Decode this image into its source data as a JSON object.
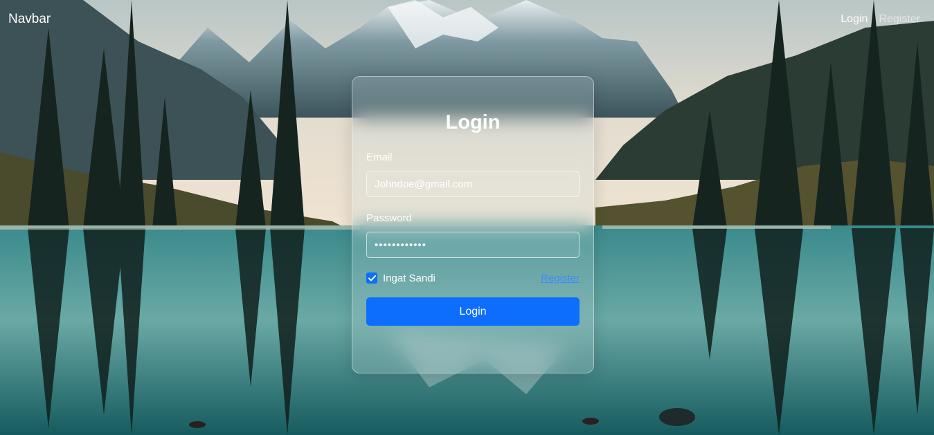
{
  "navbar": {
    "brand": "Navbar",
    "links": [
      {
        "label": "Login",
        "active": true
      },
      {
        "label": "Register",
        "active": false
      }
    ]
  },
  "background": {
    "image": "mountain-lake-forest-landscape",
    "colors": {
      "sky": "#dcd4c8",
      "mountains": "#4d6a72",
      "forest": "#1e2e22",
      "water": "#2f7e82"
    }
  },
  "login_card": {
    "title": "Login",
    "email": {
      "label": "Email",
      "value": "Johndoe@gmail.com"
    },
    "password": {
      "label": "Password",
      "value": "••••••••••••"
    },
    "remember": {
      "label": "Ingat Sandi",
      "checked": true
    },
    "register_link": "Register",
    "submit_label": "Login"
  },
  "colors": {
    "accent": "#0d6efd",
    "link": "#3d8bfd",
    "text": "#ffffff"
  }
}
